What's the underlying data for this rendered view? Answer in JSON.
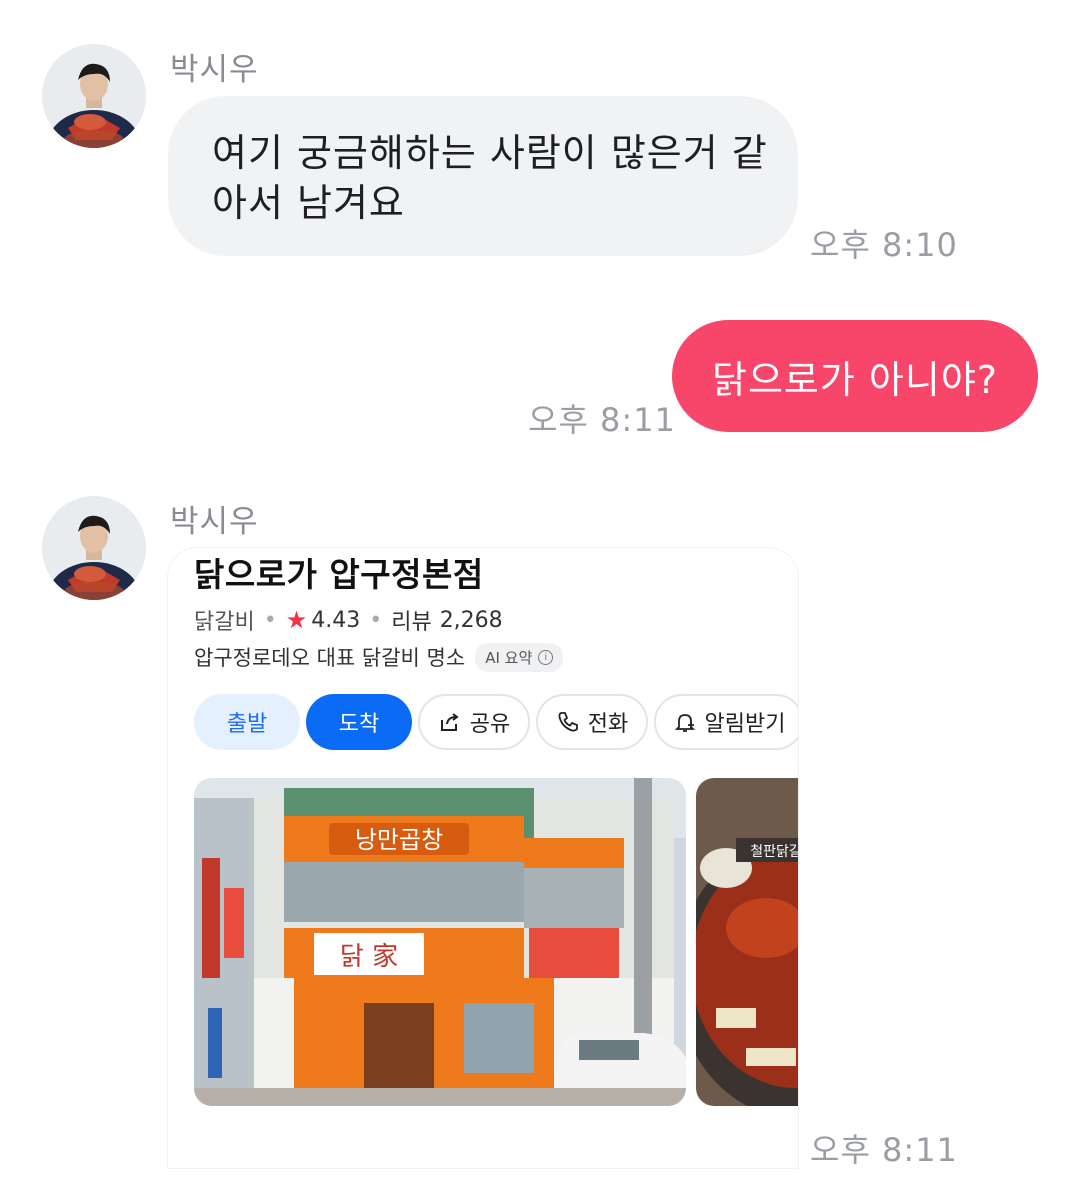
{
  "messages": [
    {
      "sender": "박시우",
      "text": "여기 궁금해하는 사람이 많은거 같아서 남겨요",
      "time": "오후 8:10"
    },
    {
      "text": "닭으로가 아니야?",
      "time": "오후 8:11"
    },
    {
      "sender": "박시우",
      "time": "오후 8:11",
      "place": {
        "name": "닭으로가 압구정본점",
        "category": "닭갈비",
        "rating": "4.43",
        "review_label": "리뷰",
        "review_count": "2,268",
        "description": "압구정로데오 대표 닭갈비 명소",
        "ai_badge": "AI 요약",
        "actions": {
          "depart": "출발",
          "arrive": "도착",
          "share": "공유",
          "call": "전화",
          "alarm": "알림받기"
        }
      }
    }
  ],
  "colors": {
    "outgoing_bubble": "#f8456a",
    "incoming_bubble": "#f1f2f4",
    "arrive_button": "#0a6cf5",
    "rating_star": "#f5304a"
  },
  "icons": {
    "share": "share-icon",
    "call": "phone-icon",
    "alarm": "bell-plus-icon",
    "star": "star-icon",
    "info": "info-icon"
  }
}
